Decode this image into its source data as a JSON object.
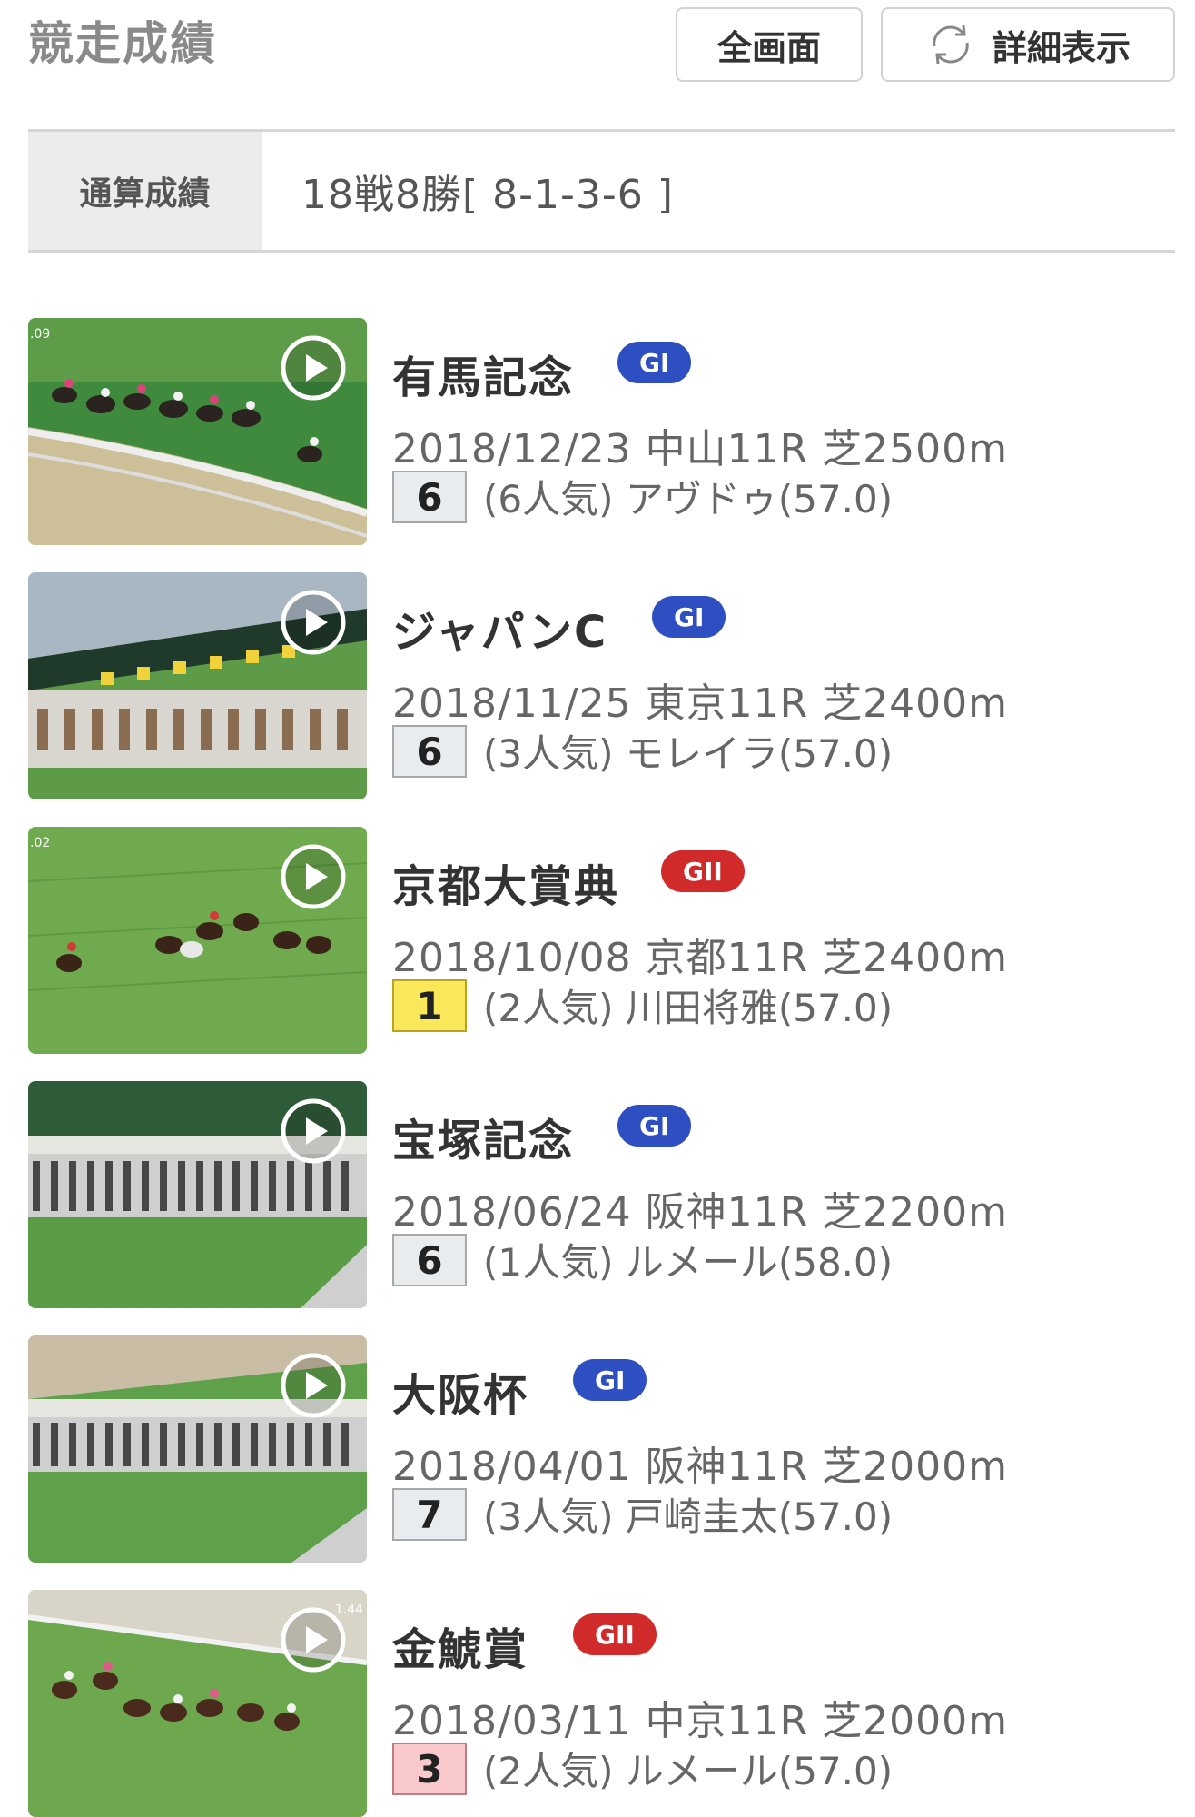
{
  "header": {
    "title": "競走成績",
    "fullscreen_label": "全画面",
    "detail_label": "詳細表示"
  },
  "summary": {
    "label": "通算成績",
    "value": "18戦8勝[ 8-1-3-6 ]"
  },
  "races": [
    {
      "name": "有馬記念",
      "grade": "GI",
      "grade_color": "#2d4fc1",
      "info": "2018/12/23 中山11R 芝2500m",
      "rank": "6",
      "result": "(6人気) アヴドゥ(57.0)",
      "overlay": ".09"
    },
    {
      "name": "ジャパンC",
      "grade": "GI",
      "grade_color": "#2d4fc1",
      "info": "2018/11/25 東京11R 芝2400m",
      "rank": "6",
      "result": "(3人気) モレイラ(57.0)",
      "overlay": ""
    },
    {
      "name": "京都大賞典",
      "grade": "GII",
      "grade_color": "#d02a2a",
      "info": "2018/10/08 京都11R 芝2400m",
      "rank": "1",
      "result": "(2人気) 川田将雅(57.0)",
      "overlay": ".02"
    },
    {
      "name": "宝塚記念",
      "grade": "GI",
      "grade_color": "#2d4fc1",
      "info": "2018/06/24 阪神11R 芝2200m",
      "rank": "6",
      "result": "(1人気) ルメール(58.0)",
      "overlay": ""
    },
    {
      "name": "大阪杯",
      "grade": "GI",
      "grade_color": "#2d4fc1",
      "info": "2018/04/01 阪神11R 芝2000m",
      "rank": "7",
      "result": "(3人気) 戸崎圭太(57.0)",
      "overlay": ""
    },
    {
      "name": "金鯱賞",
      "grade": "GII",
      "grade_color": "#d02a2a",
      "info": "2018/03/11 中京11R 芝2000m",
      "rank": "3",
      "result": "(2人気) ルメール(57.0)",
      "overlay": "1.44"
    }
  ]
}
